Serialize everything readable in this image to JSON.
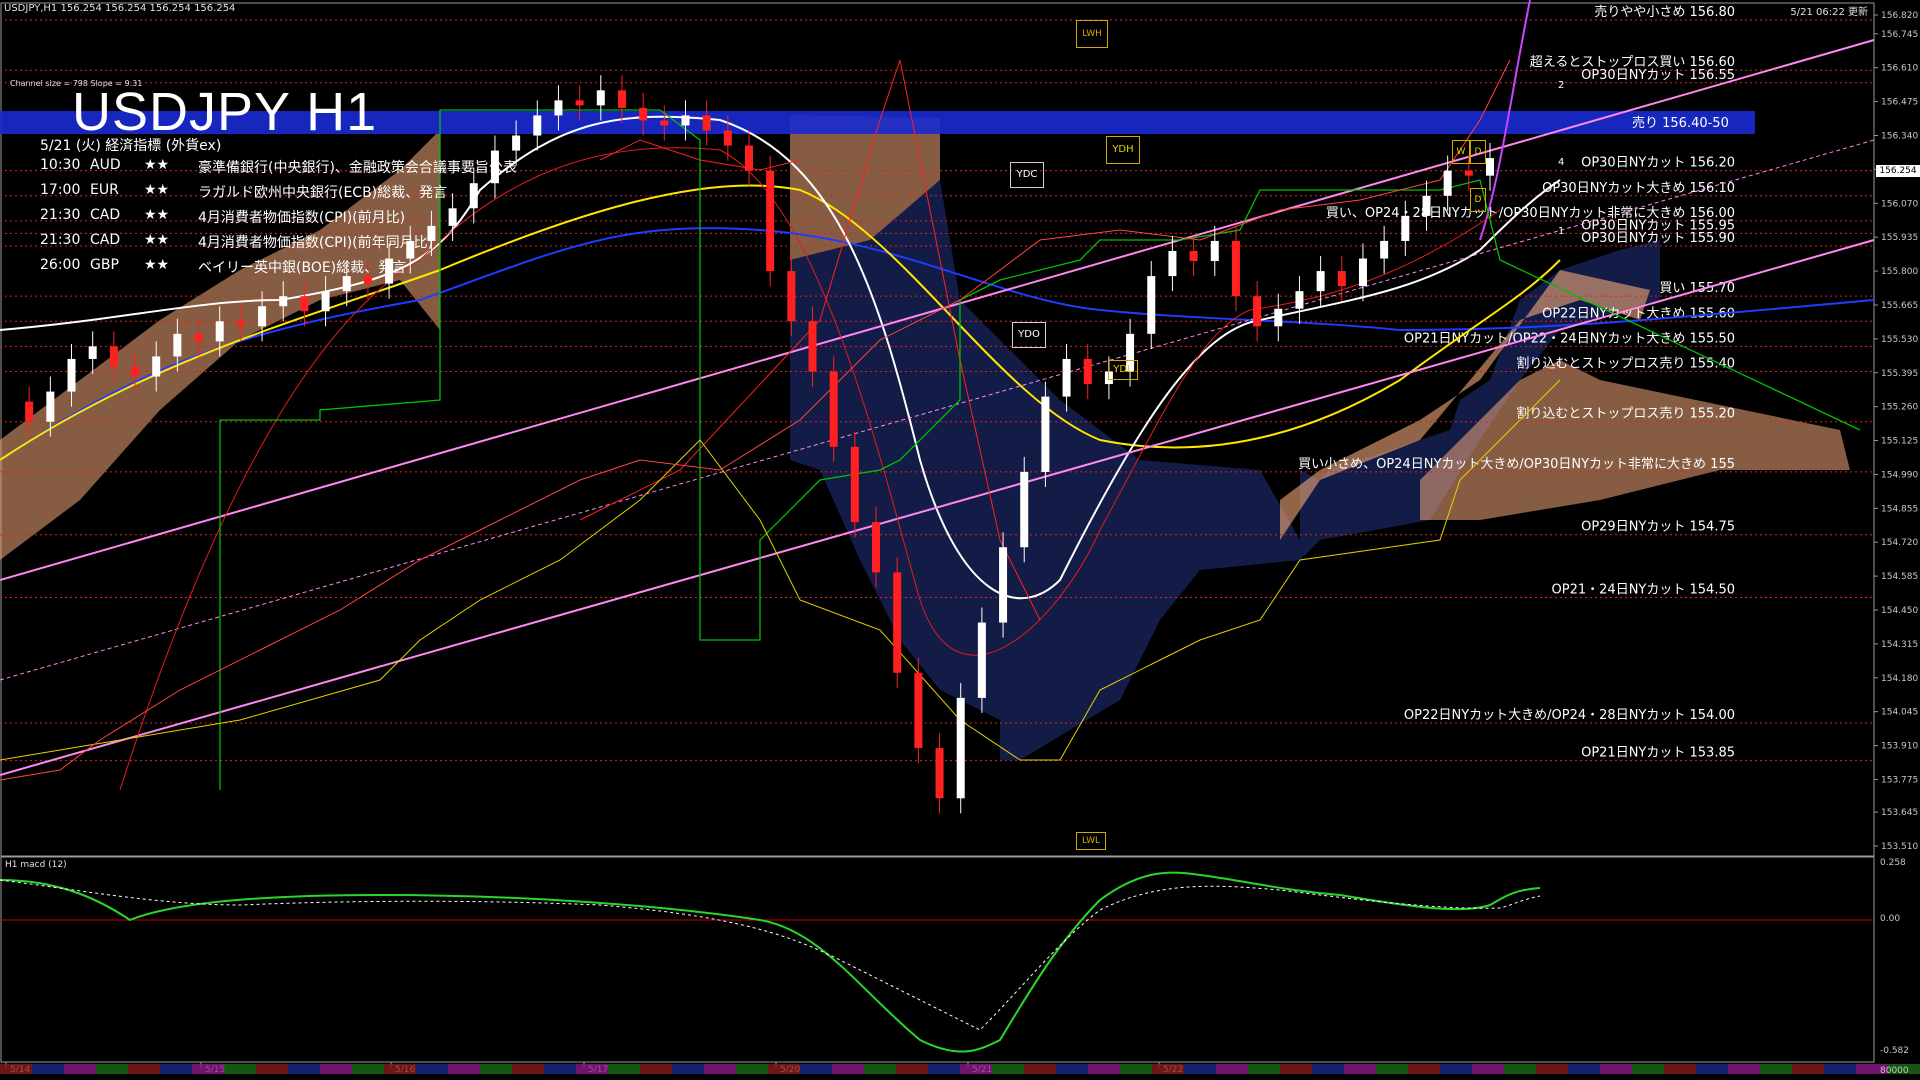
{
  "header": {
    "symbol_line": "USDJPY,H1  156.254 156.254 156.254 156.254",
    "timestamp": "5/21 06:22 更新",
    "channel_info": "Channel size = 798 Slope = 9.31"
  },
  "chart_title": "USDJPY H1",
  "events": {
    "heading": "5/21 (火) 経済指標 (外貨ex)",
    "rows": [
      {
        "time": "10:30",
        "cur": "AUD",
        "stars": "★★",
        "text": "豪準備銀行(中央銀行)、金融政策会合議事要旨公表"
      },
      {
        "time": "17:00",
        "cur": "EUR",
        "stars": "★★",
        "text": "ラガルド欧州中央銀行(ECB)総裁、発言"
      },
      {
        "time": "21:30",
        "cur": "CAD",
        "stars": "★★",
        "text": "4月消費者物価指数(CPI)(前月比)"
      },
      {
        "time": "21:30",
        "cur": "CAD",
        "stars": "★★",
        "text": "4月消費者物価指数(CPI)(前年同月比)"
      },
      {
        "time": "26:00",
        "cur": "GBP",
        "stars": "★★",
        "text": "ベイリー英中銀(BOE)総裁、発言"
      }
    ]
  },
  "markers": {
    "lwh": "LWH",
    "lwl": "LWL",
    "ydh": "YDH",
    "ydl": "YDL",
    "ydc": "YDC",
    "ydo": "YDO",
    "w": "W",
    "d": "D",
    "n1": "1",
    "n2": "2",
    "n4": "4"
  },
  "sell_zone": {
    "label": "売り 156.40-50"
  },
  "price_box": "156.254",
  "macd": {
    "label": "H1  macd (12)",
    "ticks": [
      "0.258",
      "0.00",
      "-0.582"
    ],
    "bottom_value": "80000"
  },
  "chart_data": {
    "type": "candlestick",
    "title": "USDJPY H1",
    "ylim": [
      153.51,
      156.82
    ],
    "y_ticks": [
      "156.820",
      "156.745",
      "156.610",
      "156.475",
      "156.340",
      "156.205",
      "156.070",
      "155.935",
      "155.800",
      "155.665",
      "155.530",
      "155.395",
      "155.260",
      "155.125",
      "154.990",
      "154.855",
      "154.720",
      "154.585",
      "154.450",
      "154.315",
      "154.180",
      "154.045",
      "153.910",
      "153.775",
      "153.645",
      "153.510"
    ],
    "x_ticks": [
      "5/14",
      "5/15",
      "5/16",
      "5/17",
      "5/20",
      "5/21",
      "5/22"
    ],
    "levels": [
      {
        "price": 156.8,
        "label": "売りやや小さめ 156.80"
      },
      {
        "price": 156.6,
        "label": "超えるとストップロス買い 156.60"
      },
      {
        "price": 156.55,
        "label": "OP30日NYカット 156.55"
      },
      {
        "price": 156.2,
        "label": "OP30日NYカット 156.20"
      },
      {
        "price": 156.1,
        "label": "OP30日NYカット大きめ 156.10"
      },
      {
        "price": 156.0,
        "label": "買い、OP24・28日NYカット/OP30日NYカット非常に大きめ 156.00"
      },
      {
        "price": 155.95,
        "label": "OP30日NYカット 155.95"
      },
      {
        "price": 155.9,
        "label": "OP30日NYカット 155.90"
      },
      {
        "price": 155.7,
        "label": "買い 155.70"
      },
      {
        "price": 155.6,
        "label": "OP22日NYカット大きめ 155.60"
      },
      {
        "price": 155.5,
        "label": "OP21日NYカット/OP22・24日NYカット大きめ 155.50"
      },
      {
        "price": 155.4,
        "label": "割り込むとストップロス売り 155.40"
      },
      {
        "price": 155.2,
        "label": "割り込むとストップロス売り 155.20"
      },
      {
        "price": 155.0,
        "label": "買い小さめ、OP24日NYカット大きめ/OP30日NYカット非常に大きめ 155"
      },
      {
        "price": 154.75,
        "label": "OP29日NYカット 154.75"
      },
      {
        "price": 154.5,
        "label": "OP21・24日NYカット 154.50"
      },
      {
        "price": 154.0,
        "label": "OP22日NYカット大きめ/OP24・28日NYカット 154.00"
      },
      {
        "price": 153.85,
        "label": "OP21日NYカット 153.85"
      }
    ],
    "close_series": [
      155.28,
      155.2,
      155.32,
      155.45,
      155.5,
      155.42,
      155.38,
      155.46,
      155.55,
      155.52,
      155.6,
      155.58,
      155.66,
      155.7,
      155.64,
      155.72,
      155.78,
      155.75,
      155.85,
      155.92,
      155.98,
      156.05,
      156.15,
      156.28,
      156.34,
      156.42,
      156.48,
      156.46,
      156.52,
      156.45,
      156.4,
      156.38,
      156.42,
      156.36,
      156.3,
      156.2,
      155.8,
      155.6,
      155.4,
      155.1,
      154.8,
      154.6,
      154.2,
      153.9,
      153.7,
      154.1,
      154.4,
      154.7,
      155.0,
      155.3,
      155.45,
      155.35,
      155.4,
      155.55,
      155.78,
      155.88,
      155.84,
      155.92,
      155.7,
      155.58,
      155.65,
      155.72,
      155.8,
      155.74,
      155.85,
      155.92,
      156.02,
      156.1,
      156.2,
      156.18,
      156.25
    ]
  }
}
